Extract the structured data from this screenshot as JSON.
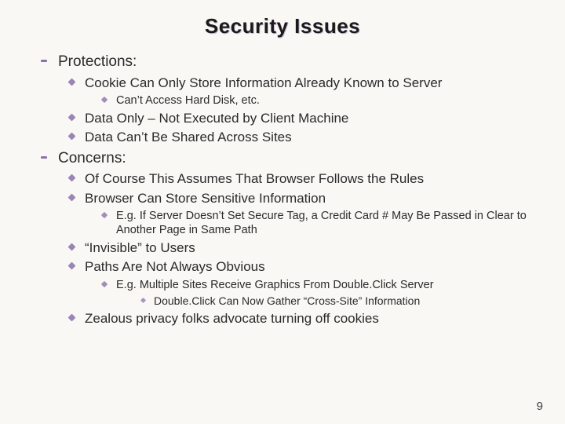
{
  "title": "Security Issues",
  "sections": {
    "protections": {
      "heading": "Protections:",
      "items": {
        "cookie_store": "Cookie Can Only Store Information Already Known to Server",
        "cant_access": "Can’t Access Hard Disk, etc.",
        "data_only": "Data Only – Not Executed by Client Machine",
        "no_share": "Data Can’t Be Shared Across Sites"
      }
    },
    "concerns": {
      "heading": "Concerns:",
      "items": {
        "assumes_rules": "Of Course This Assumes That Browser Follows the Rules",
        "store_sensitive": "Browser Can Store Sensitive Information",
        "eg_cc": "E.g. If Server Doesn’t Set Secure Tag, a Credit Card # May Be Passed in Clear to Another Page in Same Path",
        "invisible": "“Invisible” to Users",
        "paths_not_obvious": "Paths Are Not Always Obvious",
        "eg_doubleclick": "E.g. Multiple Sites Receive Graphics From Double.Click Server",
        "doubleclick_cross": "Double.Click Can Now Gather “Cross-Site” Information",
        "zealous": "Zealous privacy folks advocate turning off cookies"
      }
    }
  },
  "page_number": "9"
}
